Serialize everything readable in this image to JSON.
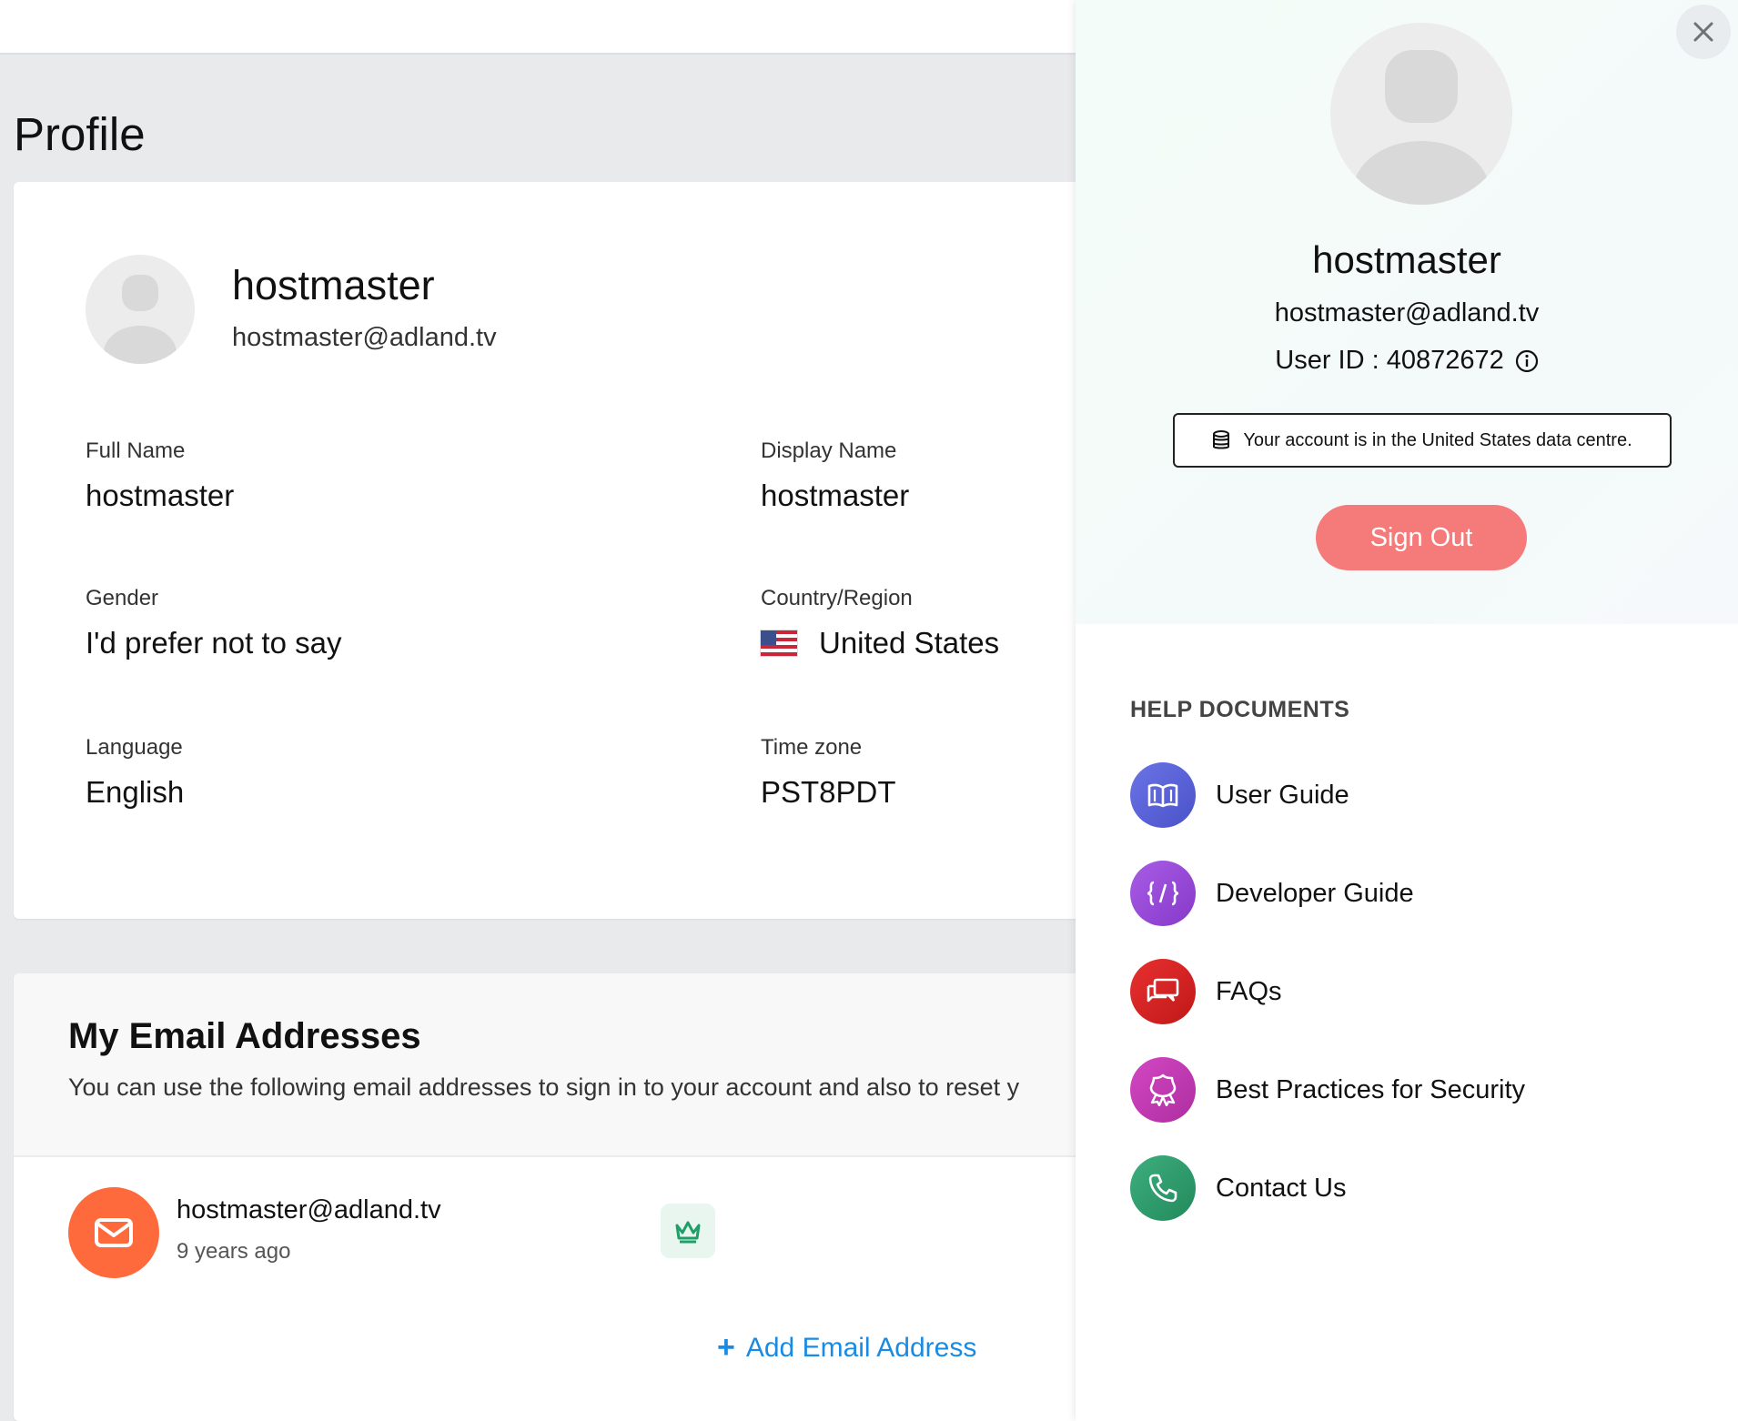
{
  "page": {
    "title": "Profile"
  },
  "profile": {
    "name": "hostmaster",
    "email": "hostmaster@adland.tv",
    "fields": {
      "full_name_label": "Full Name",
      "full_name": "hostmaster",
      "display_name_label": "Display Name",
      "display_name": "hostmaster",
      "gender_label": "Gender",
      "gender": "I'd prefer not to say",
      "country_label": "Country/Region",
      "country": "United States",
      "language_label": "Language",
      "language": "English",
      "timezone_label": "Time zone",
      "timezone": "PST8PDT"
    }
  },
  "emails": {
    "title": "My Email Addresses",
    "description": "You can use the following email addresses to sign in to your account and also to reset y",
    "items": [
      {
        "address": "hostmaster@adland.tv",
        "age": "9 years ago"
      }
    ],
    "add_label": "Add Email Address"
  },
  "panel": {
    "name": "hostmaster",
    "email": "hostmaster@adland.tv",
    "user_id": "User ID : 40872672",
    "data_centre": "Your account is in the United States data centre.",
    "signout_label": "Sign Out",
    "help_title": "HELP DOCUMENTS",
    "help_items": [
      {
        "label": "User Guide",
        "icon": "book-icon",
        "color": "#5b63d9"
      },
      {
        "label": "Developer Guide",
        "icon": "code-icon",
        "color": "#9a4ad8"
      },
      {
        "label": "FAQs",
        "icon": "chat-bubbles-icon",
        "color": "#d92424"
      },
      {
        "label": "Best Practices for Security",
        "icon": "badge-icon",
        "color": "#c23bb0"
      },
      {
        "label": "Contact Us",
        "icon": "phone-icon",
        "color": "#2e9a6c"
      }
    ]
  },
  "colors": {
    "accent_link": "#1a8be3",
    "signout": "#f57a7a",
    "email_icon_bg": "#ff6a3d"
  }
}
